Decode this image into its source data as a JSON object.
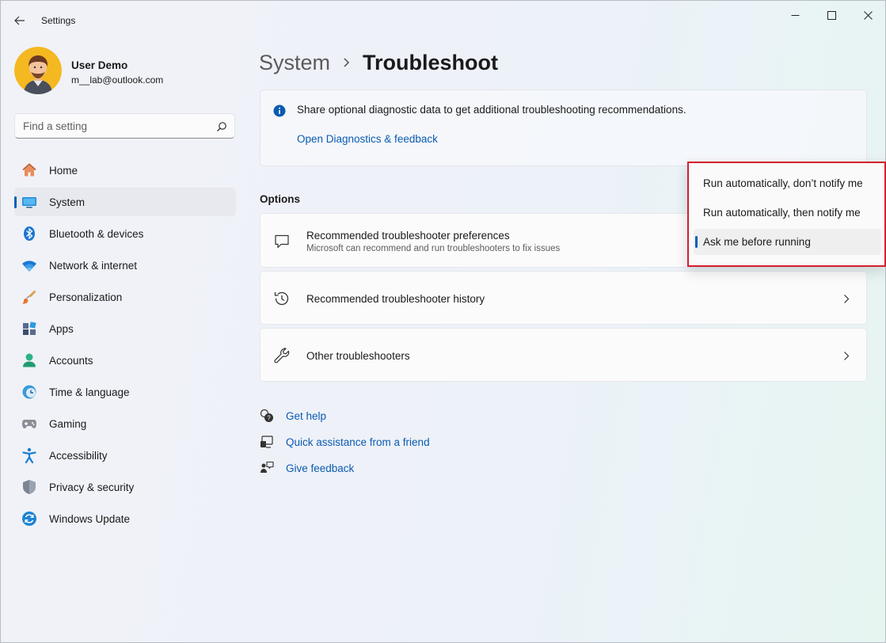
{
  "window": {
    "title": "Settings"
  },
  "user": {
    "name": "User Demo",
    "email": "m__lab@outlook.com"
  },
  "search": {
    "placeholder": "Find a setting"
  },
  "sidebar": {
    "items": [
      {
        "label": "Home",
        "icon": "home-icon"
      },
      {
        "label": "System",
        "icon": "system-icon",
        "active": true
      },
      {
        "label": "Bluetooth & devices",
        "icon": "bluetooth-icon"
      },
      {
        "label": "Network & internet",
        "icon": "network-icon"
      },
      {
        "label": "Personalization",
        "icon": "brush-icon"
      },
      {
        "label": "Apps",
        "icon": "apps-icon"
      },
      {
        "label": "Accounts",
        "icon": "accounts-icon"
      },
      {
        "label": "Time & language",
        "icon": "clock-icon"
      },
      {
        "label": "Gaming",
        "icon": "gamepad-icon"
      },
      {
        "label": "Accessibility",
        "icon": "accessibility-icon"
      },
      {
        "label": "Privacy & security",
        "icon": "shield-icon"
      },
      {
        "label": "Windows Update",
        "icon": "update-icon"
      }
    ]
  },
  "breadcrumb": {
    "parent": "System",
    "current": "Troubleshoot"
  },
  "info": {
    "text": "Share optional diagnostic data to get additional troubleshooting recommendations.",
    "link": "Open Diagnostics & feedback"
  },
  "options": {
    "header": "Options",
    "cards": [
      {
        "title": "Recommended troubleshooter preferences",
        "subtitle": "Microsoft can recommend and run troubleshooters to fix issues",
        "icon": "chat-icon"
      },
      {
        "title": "Recommended troubleshooter history",
        "icon": "history-icon"
      },
      {
        "title": "Other troubleshooters",
        "icon": "wrench-icon"
      }
    ]
  },
  "dropdown": {
    "options": [
      "Run automatically, don’t notify me",
      "Run automatically, then notify me",
      "Ask me before running"
    ],
    "selected": "Ask me before running"
  },
  "help_links": [
    {
      "label": "Get help",
      "icon": "help-icon"
    },
    {
      "label": "Quick assistance from a friend",
      "icon": "quick-assist-icon"
    },
    {
      "label": "Give feedback",
      "icon": "feedback-icon"
    }
  ],
  "colors": {
    "accent": "#005fb8",
    "link": "#0a5bb0",
    "highlight_border": "#d41f2e"
  }
}
